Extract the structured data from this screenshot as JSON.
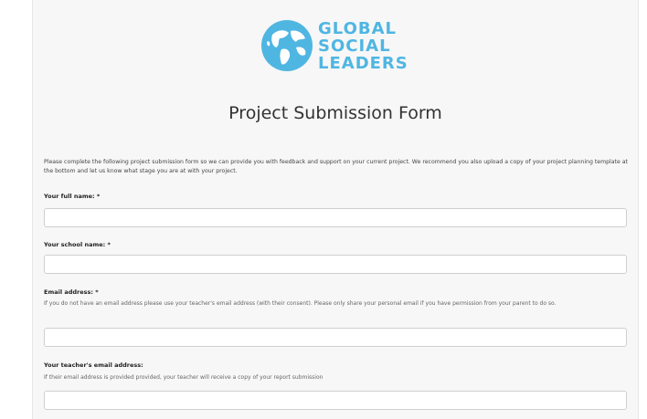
{
  "logo": {
    "lines": [
      "GLOBAL",
      "SOCIAL",
      "LEADERS"
    ],
    "accent_color": "#4fb6e2",
    "icon": "globe-icon"
  },
  "form": {
    "title": "Project Submission Form",
    "intro": "Please complete the following project submission form so we can provide you with feedback and support on your current project. We recommend you also upload a copy of your project planning template at the bottom and let us know what stage you are at with your project.",
    "fields": {
      "full_name": {
        "label": "Your full name: *",
        "value": ""
      },
      "school_name": {
        "label": "Your school name: *",
        "value": ""
      },
      "email": {
        "label": "Email address: *",
        "help": "If you do not have an email address please use your teacher's email address (with their consent). Please only share your personal email if you have permission from your parent to do so.",
        "value": ""
      },
      "teacher_email": {
        "label": "Your teacher's email address:",
        "help": "If their email address is provided provided, your teacher will receive a copy of your report submission",
        "value": ""
      }
    }
  }
}
